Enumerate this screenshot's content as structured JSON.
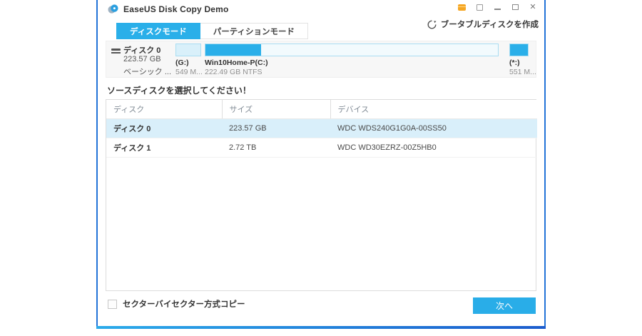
{
  "window": {
    "title": "EaseUS Disk Copy Demo",
    "controls": {
      "minimize": "–",
      "maximize": "",
      "close": "✕"
    }
  },
  "tabs": [
    {
      "label": "ディスクモード",
      "active": true
    },
    {
      "label": "パーティションモード",
      "active": false
    }
  ],
  "bootable": {
    "label": "ブータブルディスクを作成"
  },
  "disk_overview": {
    "name": "ディスク 0",
    "size": "223.57 GB",
    "type": "ベーシック ...",
    "partitions": [
      {
        "label": "(G:)",
        "size": "549 M...",
        "fill_pct": 0
      },
      {
        "label": "Win10Home-P(C:)",
        "size": "222.49 GB NTFS",
        "fill_pct": 19
      },
      {
        "label": "(*:)",
        "size": "551 M...",
        "fill_pct": 100
      }
    ]
  },
  "source_heading": "ソースディスクを選択してください！",
  "table": {
    "columns": [
      "ディスク",
      "サイズ",
      "デバイス"
    ],
    "rows": [
      {
        "disk": "ディスク 0",
        "size": "223.57 GB",
        "device": "WDC WDS240G1G0A-00SS50",
        "selected": true
      },
      {
        "disk": "ディスク 1",
        "size": "2.72 TB",
        "device": "WDC WD30EZRZ-00Z5HB0",
        "selected": false
      }
    ]
  },
  "footer": {
    "checkbox_label": "セクターバイセクター方式コピー",
    "checked": false,
    "next_label": "次へ"
  },
  "colors": {
    "accent": "#2aafe9",
    "selected_row": "#d9effa",
    "frame_blue": "#2273d8",
    "panel_bg": "#f7f7f7"
  }
}
